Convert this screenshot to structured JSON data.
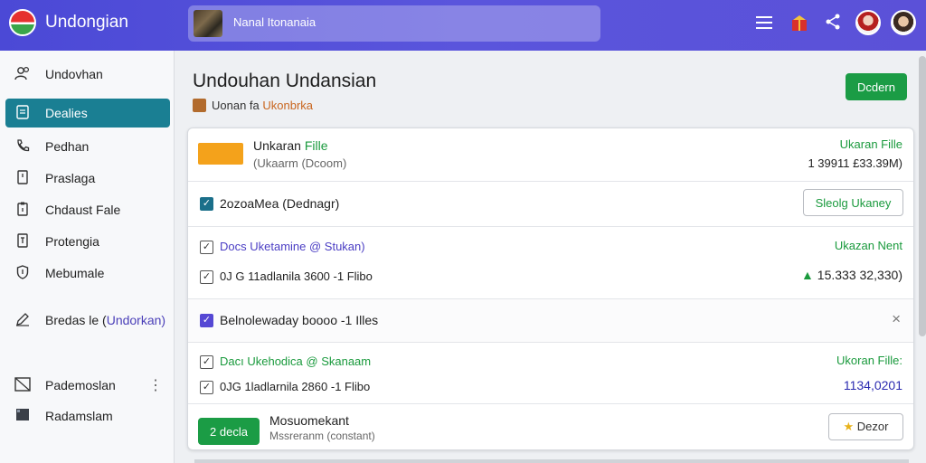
{
  "header": {
    "app_title": "Undongian",
    "search_text": "Nanal Itonanaia",
    "icons": [
      "menu-icon",
      "gift-icon",
      "share-icon",
      "avatar-1",
      "avatar-2"
    ]
  },
  "sidebar": {
    "items": [
      {
        "label": "Undovhan",
        "icon": "users-icon"
      },
      {
        "label": "Dealies",
        "icon": "tablet-icon",
        "active": true
      },
      {
        "label": "Pedhan",
        "icon": "phone-icon"
      },
      {
        "label": "Praslaga",
        "icon": "doc-icon"
      },
      {
        "label": "Chdaust Fale",
        "icon": "clipboard-icon"
      },
      {
        "label": "Protengia",
        "icon": "file-icon"
      },
      {
        "label": "Mebumale",
        "icon": "shield-icon"
      }
    ],
    "extra": {
      "label_a": "Bredas le (",
      "label_b": "Undorkan",
      "label_c": ")"
    },
    "bottom": [
      {
        "label": "Pademoslan",
        "icon": "note-icon"
      },
      {
        "label": "Radamslam",
        "icon": "monitor-icon"
      }
    ]
  },
  "main": {
    "title": "Undouhan Undansian",
    "crumb_a": "Uonan fa ",
    "crumb_b": "Ukonbrka",
    "primary_button": "Dcdern"
  },
  "card": {
    "file": {
      "title_a": "Unkaran ",
      "title_b": "Fille",
      "subtitle": "(Ukaarm (Dcoom)",
      "right_label": "Ukaran Fille",
      "right_value": "1 39911 £33.39M)"
    },
    "row1": {
      "label": "2ozoaMea (Dednagr)",
      "button": "Sleolg  Ukaney"
    },
    "row2": {
      "line1_a": "Docs Uketamine ",
      "line1_b": "@ Stukan)",
      "line2": "0J G 11adlanila 3600 -1 Flibo",
      "right_label": "Ukazan Nent",
      "right_value": "15.333 32,330)",
      "right_icon": "arrow-up-icon"
    },
    "row3": {
      "label": "Belnolewaday boooo -1 Illes"
    },
    "row4": {
      "line1_a": "Dacı Ukehodica ",
      "line1_b": "@ Skanaam",
      "line2": "0JG 1ladlarnila 2860 -1 Flibo",
      "right_label": "Ukoran Fille:",
      "right_value": "1134,0201"
    },
    "row5": {
      "button": "2 decla",
      "title": "Mosuomekant",
      "subtitle": "Mssreranm (constant)",
      "right_button": "Dezor"
    }
  },
  "colors": {
    "header": "#4b49d6",
    "accent_green": "#1b9c45",
    "active_teal": "#1a7f93",
    "purple": "#4b3ec4"
  }
}
